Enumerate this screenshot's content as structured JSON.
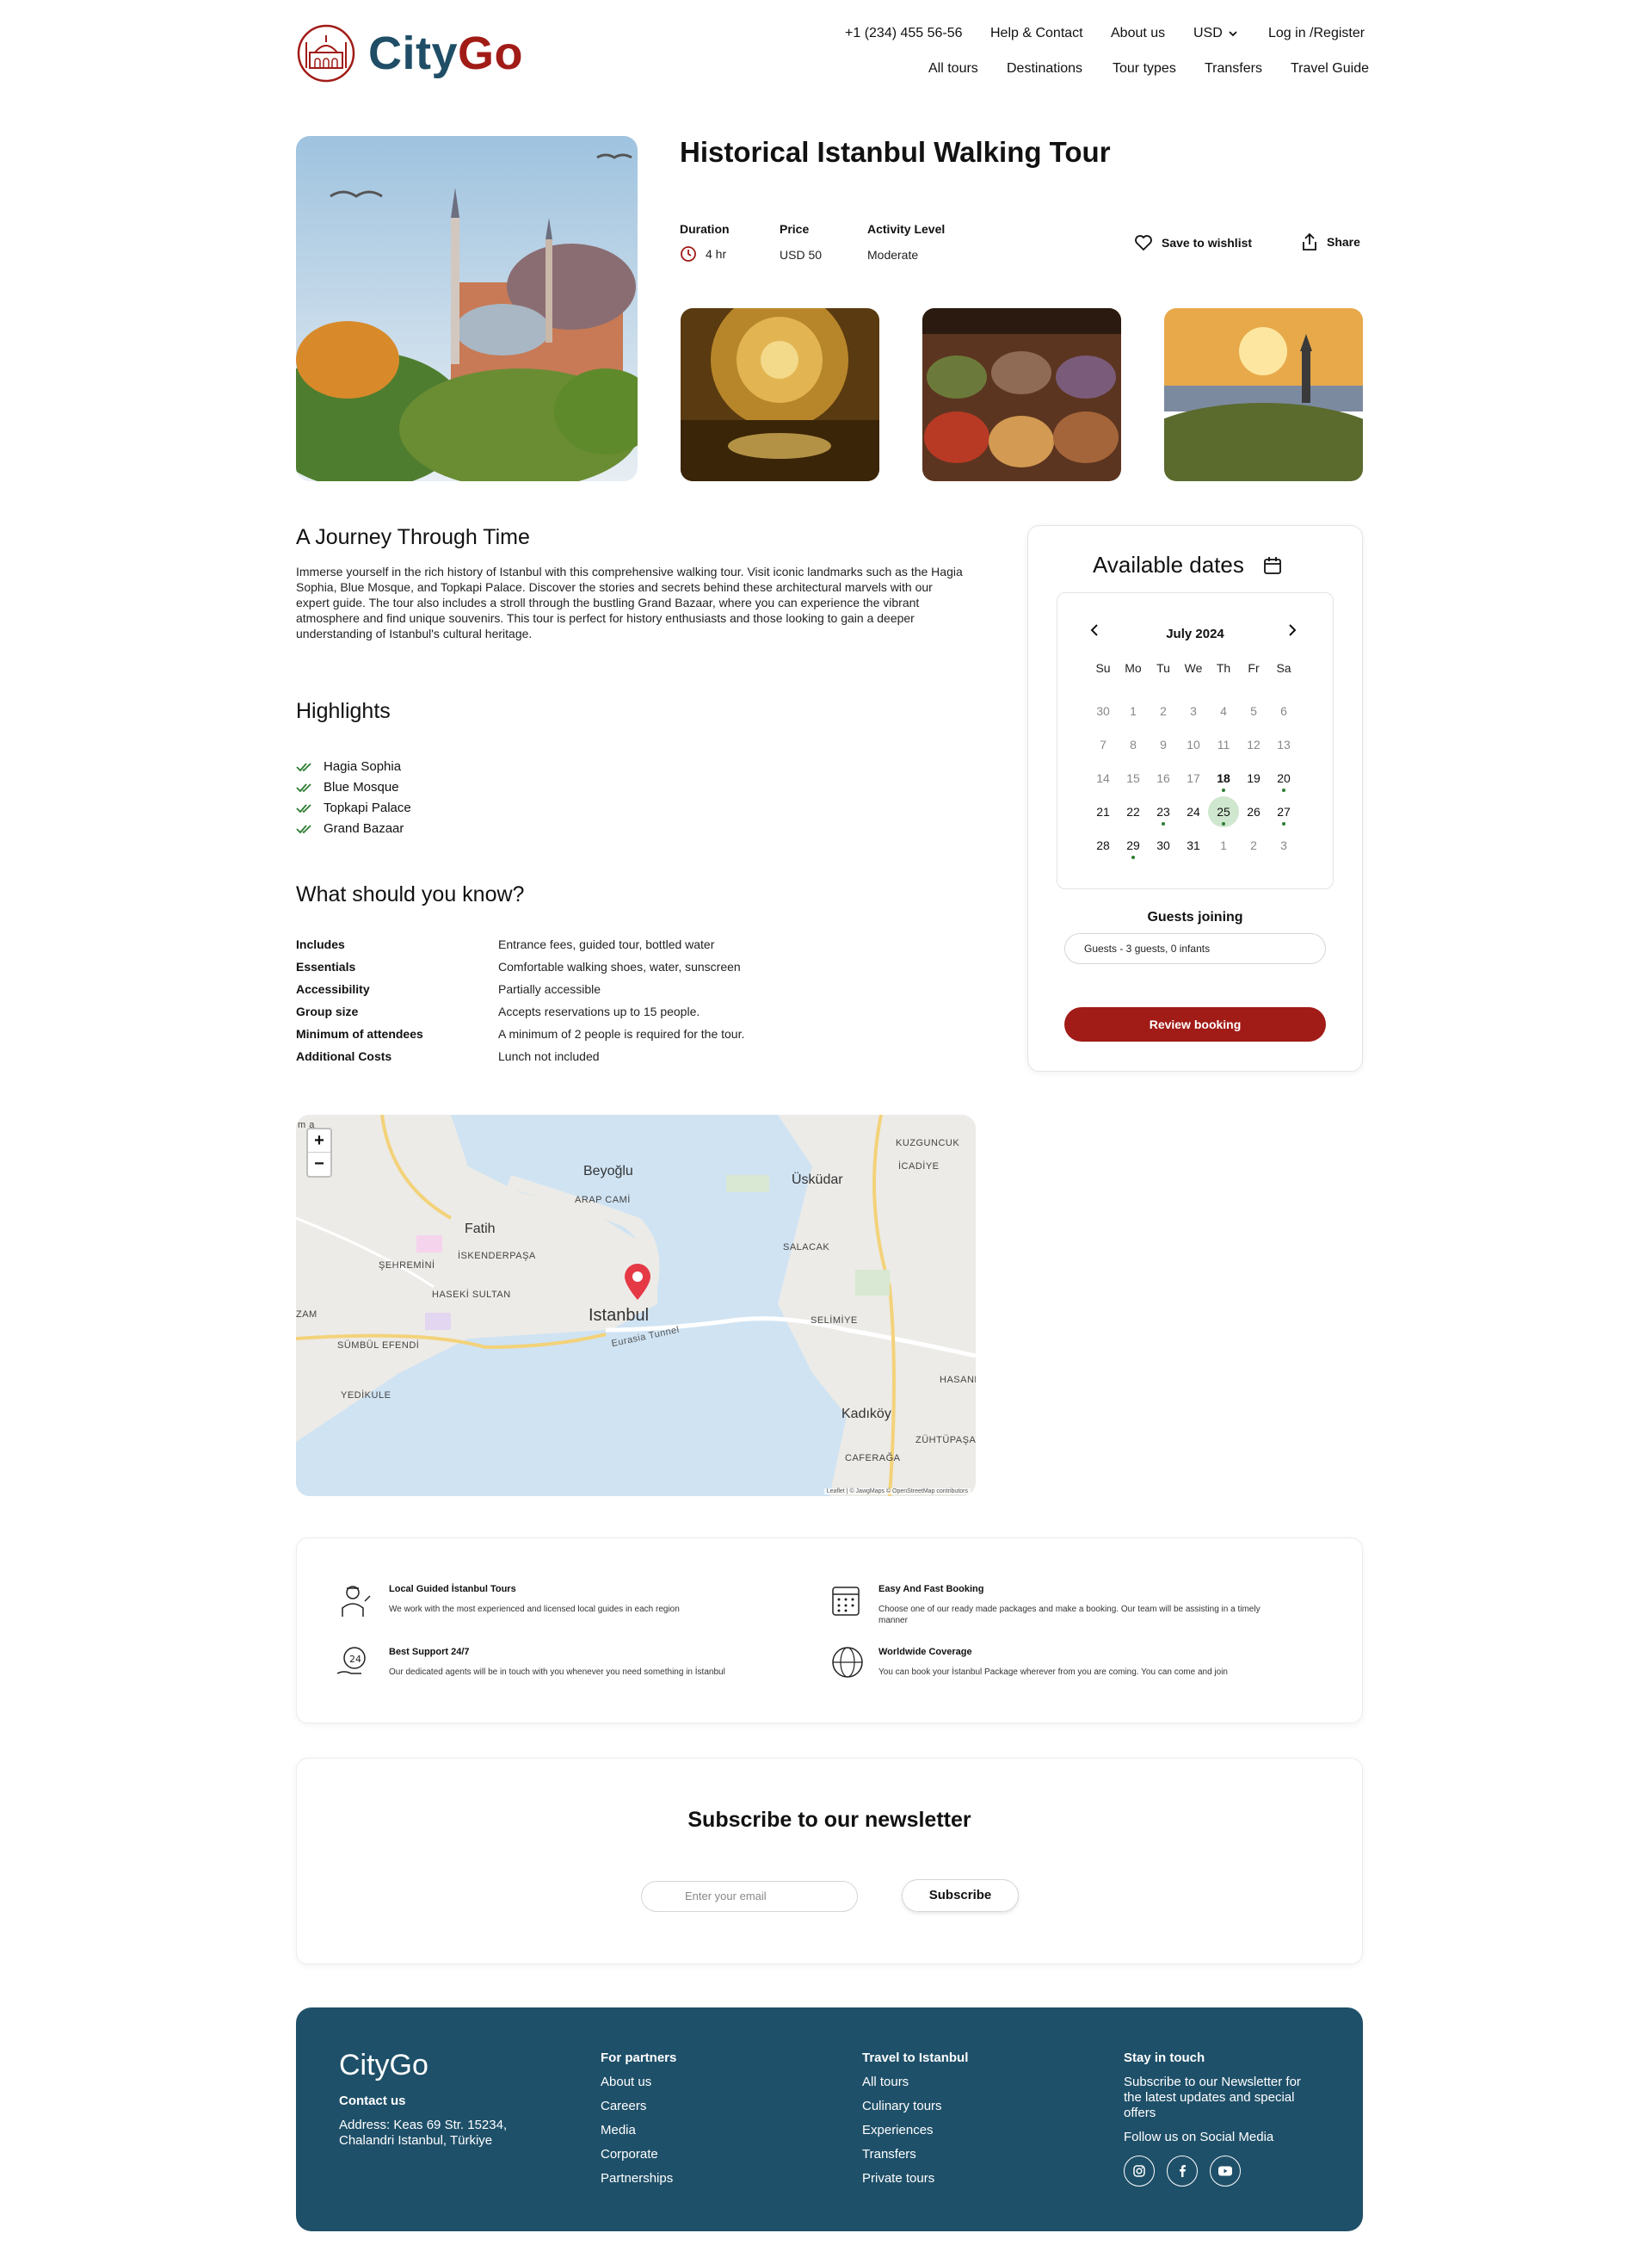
{
  "brand": {
    "name_part1": "City",
    "name_part2": "Go"
  },
  "topbar": {
    "phone": "+1 (234) 455 56-56",
    "help": "Help & Contact",
    "about": "About us",
    "currency": "USD",
    "login": "Log in /Register"
  },
  "mainnav": [
    "All tours",
    "Destinations",
    "Tour types",
    "Transfers",
    "Travel Guide"
  ],
  "tour": {
    "title": "Historical Istanbul Walking Tour",
    "duration_label": "Duration",
    "duration_value": "4 hr",
    "price_label": "Price",
    "price_value": "USD 50",
    "activity_label": "Activity Level",
    "activity_value": "Moderate",
    "wishlist": "Save to wishlist",
    "share": "Share"
  },
  "journey": {
    "heading": "A Journey Through Time",
    "text": "Immerse yourself in the rich history of Istanbul with this comprehensive walking tour. Visit iconic landmarks such as the Hagia Sophia, Blue Mosque, and Topkapi Palace. Discover the stories and secrets behind these architectural marvels with our expert guide. The tour also includes a stroll through the bustling Grand Bazaar, where you can experience the vibrant atmosphere and find unique souvenirs. This tour is perfect for history enthusiasts and those looking to gain a deeper understanding of Istanbul's cultural heritage."
  },
  "highlights": {
    "heading": "Highlights",
    "items": [
      "Hagia Sophia",
      "Blue Mosque",
      "Topkapi Palace",
      "Grand Bazaar"
    ]
  },
  "know": {
    "heading": "What should you know?",
    "rows": [
      {
        "label": "Includes",
        "value": "Entrance fees, guided tour, bottled water"
      },
      {
        "label": "Essentials",
        "value": "Comfortable walking shoes, water, sunscreen"
      },
      {
        "label": "Accessibility",
        "value": "Partially accessible"
      },
      {
        "label": "Group size",
        "value": "Accepts reservations up to 15 people."
      },
      {
        "label": "Minimum of attendees",
        "value": "A minimum of 2 people is required for the tour."
      },
      {
        "label": "Additional Costs",
        "value": "Lunch not included"
      }
    ]
  },
  "booking": {
    "heading": "Available dates",
    "month": "July 2024",
    "weekdays": [
      "Su",
      "Mo",
      "Tu",
      "We",
      "Th",
      "Fr",
      "Sa"
    ],
    "weeks": [
      [
        "30",
        "1",
        "2",
        "3",
        "4",
        "5",
        "6"
      ],
      [
        "7",
        "8",
        "9",
        "10",
        "11",
        "12",
        "13"
      ],
      [
        "14",
        "15",
        "16",
        "17",
        "18",
        "19",
        "20"
      ],
      [
        "21",
        "22",
        "23",
        "24",
        "25",
        "26",
        "27"
      ],
      [
        "28",
        "29",
        "30",
        "31",
        "1",
        "2",
        "3"
      ]
    ],
    "selected_day": "25",
    "available_days": [
      "18",
      "20",
      "23",
      "25",
      "27",
      "29"
    ],
    "guests_label": "Guests joining",
    "guests_value": "Guests - 3 guests, 0 infants",
    "review_button": "Review booking"
  },
  "map": {
    "labels": {
      "beyoglu": "Beyoğlu",
      "uskudar": "Üsküdar",
      "fatih": "Fatih",
      "istanbul": "Istanbul",
      "kadikoy": "Kadıköy",
      "arap_cami": "ARAP CAMİ",
      "kuzguncuk": "KUZGUNCUK",
      "icadiye": "İCADİYE",
      "salacak": "SALACAK",
      "iskenderpasa": "İSKENDERPAŞA",
      "sehremini": "ŞEHREMİNİ",
      "haseki": "HASEKİ SULTAN",
      "selimiye": "SELİMİYE",
      "sumbul": "SÜMBÜL EFENDİ",
      "yedikule": "YEDİKULE",
      "hasanpasa": "HASANP",
      "zuhtupasa": "ZÜHTÜPAŞA",
      "caferaga": "CAFERAĞA",
      "tunnel": "Eurasia Tunnel",
      "zam": "ZAM",
      "corner": "m a"
    },
    "zoom_in": "+",
    "zoom_out": "−",
    "attribution": "Leaflet | © JawgMaps © OpenStreetMap contributors"
  },
  "features": [
    {
      "title": "Local Guided İstanbul Tours",
      "desc": "We work with the most experienced and licensed local guides in each region",
      "icon": "guide-icon"
    },
    {
      "title": "Easy And Fast Booking",
      "desc": "Choose one of our ready made packages and make a booking. Our team will be assisting in a timely manner",
      "icon": "calendar-booking-icon"
    },
    {
      "title": "Best Support 24/7",
      "desc": "Our dedicated agents will be in touch with you whenever you need something in İstanbul",
      "icon": "support-icon"
    },
    {
      "title": "Worldwide Coverage",
      "desc": "You can book your İstanbul Package wherever from you are coming. You can come and join",
      "icon": "globe-icon"
    }
  ],
  "newsletter": {
    "heading": "Subscribe to our newsletter",
    "placeholder": "Enter your email",
    "button": "Subscribe"
  },
  "footer": {
    "brand": "CityGo",
    "contact_heading": "Contact us",
    "address": "Address: Keas 69 Str. 15234, Chalandri Istanbul, Türkiye",
    "partners_heading": "For partners",
    "partners_links": [
      "About us",
      "Careers",
      "Media",
      "Corporate",
      "Partnerships"
    ],
    "travel_heading": "Travel to Istanbul",
    "travel_links": [
      "All tours",
      "Culinary tours",
      "Experiences",
      "Transfers",
      "Private tours"
    ],
    "stay_heading": "Stay in touch",
    "stay_text": "Subscribe to our Newsletter for the latest updates and special offers",
    "follow": "Follow us on Social Media",
    "social": [
      "instagram-icon",
      "facebook-icon",
      "youtube-icon"
    ]
  },
  "colors": {
    "brand_red": "#a11b17",
    "brand_blue": "#1f4e66",
    "footer_bg": "#1f5069",
    "available_dot": "#2e7d32",
    "selected_bg": "#cfe6cf"
  }
}
